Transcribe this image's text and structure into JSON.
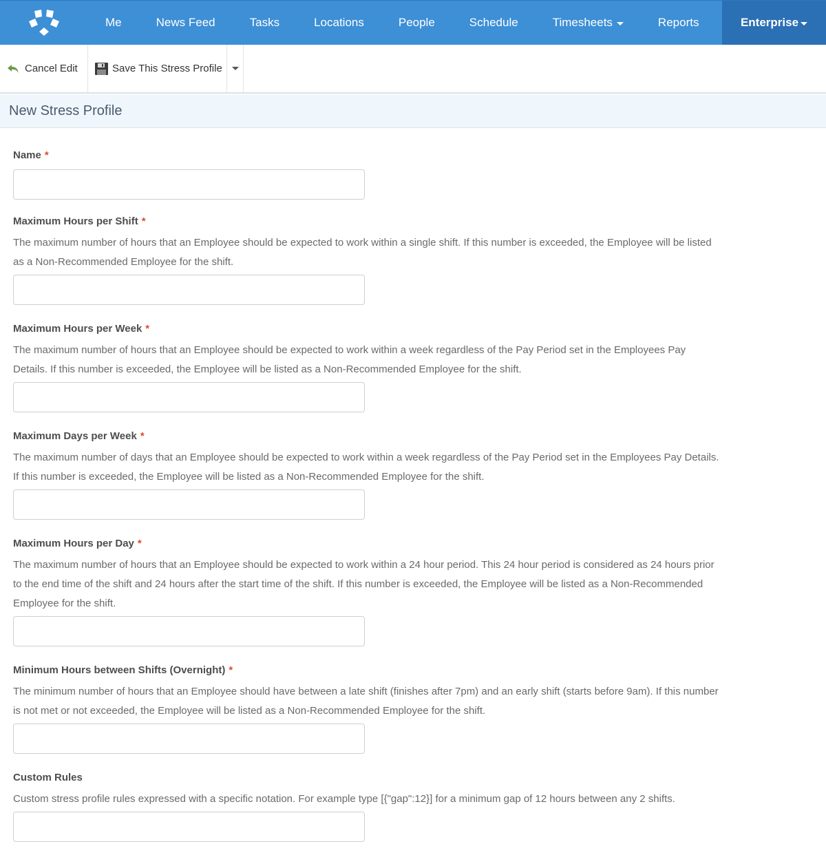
{
  "nav": {
    "logo": "app-logo",
    "items": [
      {
        "label": "Me"
      },
      {
        "label": "News Feed"
      },
      {
        "label": "Tasks"
      },
      {
        "label": "Locations"
      },
      {
        "label": "People"
      },
      {
        "label": "Schedule"
      },
      {
        "label": "Timesheets",
        "dropdown": true
      },
      {
        "label": "Reports"
      }
    ],
    "active_item": {
      "label": "Enterprise",
      "dropdown": true
    },
    "colors": {
      "bar": "#3d8fd6",
      "active": "#2b6fb4"
    }
  },
  "toolbar": {
    "cancel_label": "Cancel Edit",
    "cancel_icon": "undo-arrow-icon",
    "save_label": "Save This Stress Profile",
    "save_icon": "floppy-disk-icon",
    "more_icon": "caret-down-icon"
  },
  "page": {
    "title": "New Stress Profile"
  },
  "form": {
    "required_marker": "*",
    "fields": [
      {
        "label": "Name",
        "required": true,
        "description": "",
        "value": "",
        "placeholder": ""
      },
      {
        "label": "Maximum Hours per Shift",
        "required": true,
        "description": "The maximum number of hours that an Employee should be expected to work within a single shift. If this number is exceeded, the Employee will be listed as a Non-Recommended Employee for the shift.",
        "value": "",
        "placeholder": ""
      },
      {
        "label": "Maximum Hours per Week",
        "required": true,
        "description": "The maximum number of hours that an Employee should be expected to work within a week regardless of the Pay Period set in the Employees Pay Details. If this number is exceeded, the Employee will be listed as a Non-Recommended Employee for the shift.",
        "value": "",
        "placeholder": ""
      },
      {
        "label": "Maximum Days per Week",
        "required": true,
        "description": "The maximum number of days that an Employee should be expected to work within a week regardless of the Pay Period set in the Employees Pay Details. If this number is exceeded, the Employee will be listed as a Non-Recommended Employee for the shift.",
        "value": "",
        "placeholder": ""
      },
      {
        "label": "Maximum Hours per Day",
        "required": true,
        "description": "The maximum number of hours that an Employee should be expected to work within a 24 hour period. This 24 hour period is considered as 24 hours prior to the end time of the shift and 24 hours after the start time of the shift. If this number is exceeded, the Employee will be listed as a Non-Recommended Employee for the shift.",
        "value": "",
        "placeholder": ""
      },
      {
        "label": "Minimum Hours between Shifts (Overnight)",
        "required": true,
        "description": "The minimum number of hours that an Employee should have between a late shift (finishes after 7pm) and an early shift (starts before 9am). If this number is not met or not exceeded, the Employee will be listed as a Non-Recommended Employee for the shift.",
        "value": "",
        "placeholder": ""
      },
      {
        "label": "Custom Rules",
        "required": false,
        "description": "Custom stress profile rules expressed with a specific notation. For example type [{\"gap\":12}] for a minimum gap of 12 hours between any 2 shifts.",
        "value": "",
        "placeholder": ""
      }
    ]
  }
}
